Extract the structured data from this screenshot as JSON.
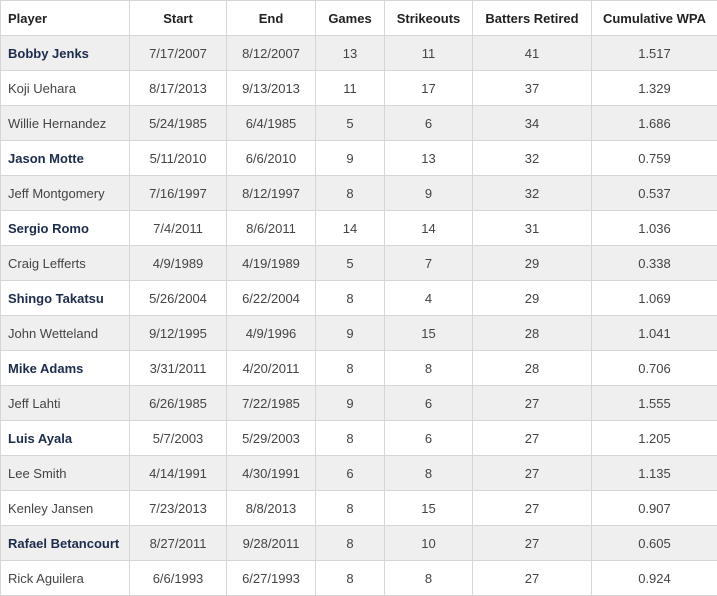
{
  "table": {
    "headers": [
      "Player",
      "Start",
      "End",
      "Games",
      "Strikeouts",
      "Batters Retired",
      "Cumulative WPA"
    ],
    "rows": [
      {
        "player": "Bobby Jenks",
        "bold": true,
        "start": "7/17/2007",
        "end": "8/12/2007",
        "games": "13",
        "strikeouts": "11",
        "retired": "41",
        "wpa": "1.517"
      },
      {
        "player": "Koji Uehara",
        "bold": false,
        "start": "8/17/2013",
        "end": "9/13/2013",
        "games": "11",
        "strikeouts": "17",
        "retired": "37",
        "wpa": "1.329"
      },
      {
        "player": "Willie Hernandez",
        "bold": false,
        "start": "5/24/1985",
        "end": "6/4/1985",
        "games": "5",
        "strikeouts": "6",
        "retired": "34",
        "wpa": "1.686"
      },
      {
        "player": "Jason Motte",
        "bold": true,
        "start": "5/11/2010",
        "end": "6/6/2010",
        "games": "9",
        "strikeouts": "13",
        "retired": "32",
        "wpa": "0.759"
      },
      {
        "player": "Jeff Montgomery",
        "bold": false,
        "start": "7/16/1997",
        "end": "8/12/1997",
        "games": "8",
        "strikeouts": "9",
        "retired": "32",
        "wpa": "0.537"
      },
      {
        "player": "Sergio Romo",
        "bold": true,
        "start": "7/4/2011",
        "end": "8/6/2011",
        "games": "14",
        "strikeouts": "14",
        "retired": "31",
        "wpa": "1.036"
      },
      {
        "player": "Craig Lefferts",
        "bold": false,
        "start": "4/9/1989",
        "end": "4/19/1989",
        "games": "5",
        "strikeouts": "7",
        "retired": "29",
        "wpa": "0.338"
      },
      {
        "player": "Shingo Takatsu",
        "bold": true,
        "start": "5/26/2004",
        "end": "6/22/2004",
        "games": "8",
        "strikeouts": "4",
        "retired": "29",
        "wpa": "1.069"
      },
      {
        "player": "John Wetteland",
        "bold": false,
        "start": "9/12/1995",
        "end": "4/9/1996",
        "games": "9",
        "strikeouts": "15",
        "retired": "28",
        "wpa": "1.041"
      },
      {
        "player": "Mike Adams",
        "bold": true,
        "start": "3/31/2011",
        "end": "4/20/2011",
        "games": "8",
        "strikeouts": "8",
        "retired": "28",
        "wpa": "0.706"
      },
      {
        "player": "Jeff Lahti",
        "bold": false,
        "start": "6/26/1985",
        "end": "7/22/1985",
        "games": "9",
        "strikeouts": "6",
        "retired": "27",
        "wpa": "1.555"
      },
      {
        "player": "Luis Ayala",
        "bold": true,
        "start": "5/7/2003",
        "end": "5/29/2003",
        "games": "8",
        "strikeouts": "6",
        "retired": "27",
        "wpa": "1.205"
      },
      {
        "player": "Lee Smith",
        "bold": false,
        "start": "4/14/1991",
        "end": "4/30/1991",
        "games": "6",
        "strikeouts": "8",
        "retired": "27",
        "wpa": "1.135"
      },
      {
        "player": "Kenley Jansen",
        "bold": false,
        "start": "7/23/2013",
        "end": "8/8/2013",
        "games": "8",
        "strikeouts": "15",
        "retired": "27",
        "wpa": "0.907"
      },
      {
        "player": "Rafael Betancourt",
        "bold": true,
        "start": "8/27/2011",
        "end": "9/28/2011",
        "games": "8",
        "strikeouts": "10",
        "retired": "27",
        "wpa": "0.605"
      },
      {
        "player": "Rick Aguilera",
        "bold": false,
        "start": "6/6/1993",
        "end": "6/27/1993",
        "games": "8",
        "strikeouts": "8",
        "retired": "27",
        "wpa": "0.924"
      }
    ]
  }
}
